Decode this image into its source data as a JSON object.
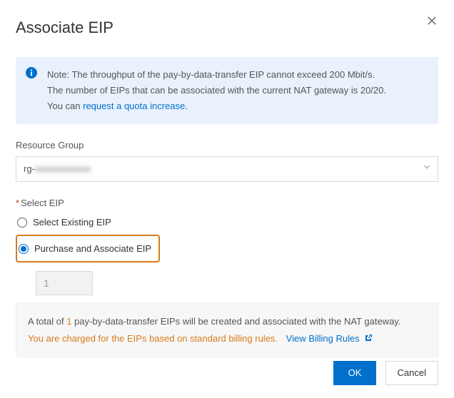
{
  "title": "Associate EIP",
  "note": {
    "line1": "Note: The throughput of the pay-by-data-transfer EIP cannot exceed 200 Mbit/s.",
    "line2": "The number of EIPs that can be associated with the current NAT gateway is 20/20.",
    "line3_prefix": "You can ",
    "line3_link": "request a quota increase",
    "line3_suffix": "."
  },
  "resource_group": {
    "label": "Resource Group",
    "value_prefix": "rg-",
    "value_blur": "xxxxxxxxxxxx"
  },
  "select_eip": {
    "label": "Select EIP",
    "options": {
      "existing": "Select Existing EIP",
      "purchase": "Purchase and Associate EIP"
    },
    "selected": "purchase",
    "quantity": "1"
  },
  "summary": {
    "line1_a": "A total of ",
    "line1_count": "1",
    "line1_b": " pay-by-data-transfer EIPs will be created and associated with the NAT gateway.",
    "line2_warn": "You are charged for the EIPs based on standard billing rules.",
    "line2_link": "View Billing Rules"
  },
  "buttons": {
    "ok": "OK",
    "cancel": "Cancel"
  }
}
